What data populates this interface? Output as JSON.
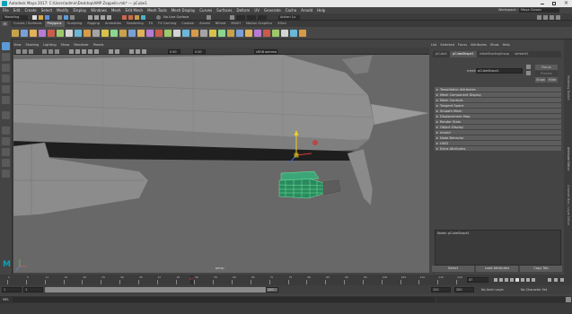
{
  "window": {
    "title": "Autodesk Maya 2017: C:\\Users\\admin\\Desktop\\AMP Zeppelin.mb* --- pCube1"
  },
  "menubar": {
    "items": [
      "File",
      "Edit",
      "Create",
      "Select",
      "Modify",
      "Display",
      "Windows",
      "Mesh",
      "Edit Mesh",
      "Mesh Tools",
      "Mesh Display",
      "Curves",
      "Surfaces",
      "Deform",
      "UV",
      "Generate",
      "Cache",
      "Arnold",
      "Help"
    ],
    "workspace_label": "Workspace :",
    "workspace_value": "Maya Classic"
  },
  "statusline": {
    "mode": "Modeling",
    "no_live_surface": "No Live Surface",
    "user": "Adrian Lu"
  },
  "shelf": {
    "tabs": [
      "Curves / Surfaces",
      "Polygons",
      "Sculpting",
      "Rigging",
      "Animation",
      "Rendering",
      "FX",
      "FX Caching",
      "Custom",
      "Arnold",
      "Bifrost",
      "MASH",
      "Motion Graphics",
      "XGen"
    ],
    "active_tab": "Polygons",
    "icon_colors": [
      "#c6a24a",
      "#7a9fd6",
      "#e0b35a",
      "#b97ad6",
      "#c95c4a",
      "#9ec96a",
      "#d4d4d4",
      "#6ab7d6",
      "#d69b4a",
      "#a4a4a4",
      "#d6c24a",
      "#8ad68f"
    ]
  },
  "viewport": {
    "panel_menu": [
      "View",
      "Shading",
      "Lighting",
      "Show",
      "Renderer",
      "Panels"
    ],
    "colorspace": "sRGB gamma",
    "field_value": "0.00",
    "camera": "persp"
  },
  "attribute_editor": {
    "tabs": [
      "List",
      "Selected",
      "Focus",
      "Attributes",
      "Show",
      "Help"
    ],
    "node_tabs": [
      "pCube1",
      "pCubeShape1",
      "initialShadingGroup",
      "lambert1"
    ],
    "active_node_tab": "pCubeShape1",
    "mesh_label": "mesh:",
    "mesh_value": "pCubeShape1",
    "focus_button": "Focus",
    "presets_button": "Presets",
    "show_button": "Show",
    "hide_button": "Hide",
    "sections": [
      "Tessellation Attributes",
      "Mesh Component Display",
      "Mesh Controls",
      "Tangent Space",
      "Smooth Mesh",
      "Displacement Map",
      "Render Stats",
      "Object Display",
      "Arnold",
      "Node Behavior",
      "UUID",
      "Extra Attributes"
    ],
    "notes_label": "Notes:  pCubeShape1",
    "select_button": "Select",
    "load_attributes_button": "Load Attributes",
    "copy_tab_button": "Copy Tab",
    "side_tabs": [
      "Attribute Editor",
      "Channel Box / Layer Editor",
      "Modeling Toolkit"
    ]
  },
  "timeline": {
    "ticks": [
      "1",
      "5",
      "10",
      "15",
      "20",
      "25",
      "30",
      "35",
      "40",
      "45",
      "50",
      "55",
      "60",
      "65",
      "70",
      "75",
      "80",
      "85",
      "90",
      "95",
      "100",
      "105",
      "110",
      "115",
      "120"
    ],
    "current_frame": "47",
    "current_frame_field": "47",
    "range_start": "1",
    "range_start_inner": "1",
    "range_end_inner": "120",
    "range_end": "120",
    "anim_end": "200",
    "anim_layer": "No Anim Layer",
    "character_set": "No Character Set",
    "fps": "24 fps"
  },
  "command_line": {
    "label": "MEL"
  },
  "colors": {
    "selection_green": "#6ee8a0",
    "accent_blue": "#5a9bd5",
    "active_tab_blue": "#3a7fbf"
  }
}
